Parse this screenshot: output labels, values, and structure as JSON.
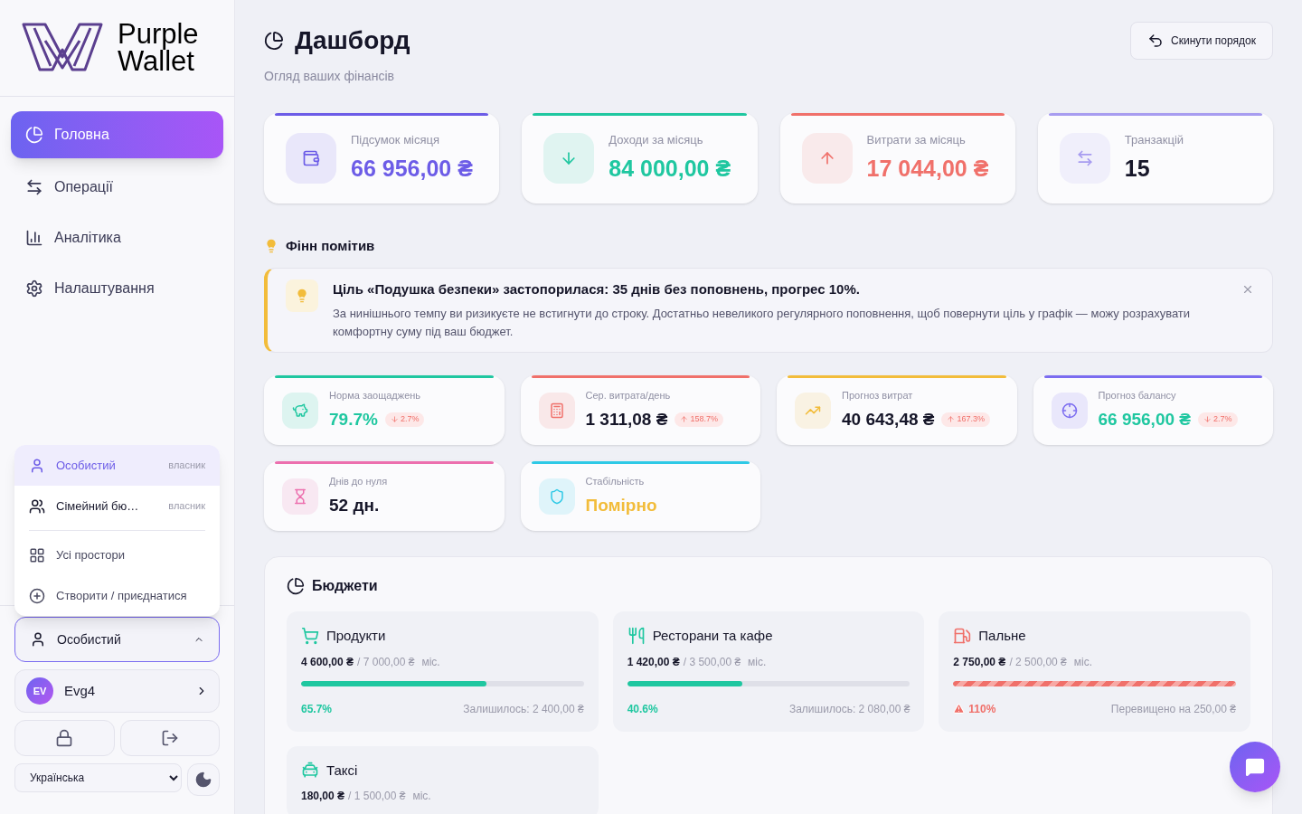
{
  "brand": {
    "lines": [
      "Purple",
      "Wallet"
    ]
  },
  "nav": [
    {
      "label": "Головна",
      "selected": true
    },
    {
      "label": "Операції",
      "selected": false
    },
    {
      "label": "Аналітика",
      "selected": false
    },
    {
      "label": "Налаштування",
      "selected": false
    }
  ],
  "space_menu": {
    "spaces": [
      {
        "label": "Особистий",
        "role": "власник",
        "selected": true
      },
      {
        "label": "Сімейний бю…",
        "role": "власник",
        "selected": false
      }
    ],
    "actions": [
      "Усі простори",
      "Створити / приєднатися"
    ]
  },
  "space_select": {
    "label": "Особистий",
    "expanded": true
  },
  "user": {
    "initials": "EV",
    "name": "Evg4"
  },
  "language": "Українська",
  "header": {
    "title": "Дашборд",
    "subtitle": "Огляд ваших фінансів",
    "reset_button": "Скинути порядок"
  },
  "summary_cards": [
    {
      "label": "Підсумок місяця",
      "value": "66 956,00 ₴",
      "color": "#6c5ce7",
      "kind": "accent"
    },
    {
      "label": "Доходи за місяць",
      "value": "84 000,00 ₴",
      "color": "#1fc7a0",
      "kind": "accent"
    },
    {
      "label": "Витрати за місяць",
      "value": "17 044,00 ₴",
      "color": "#f0706a",
      "kind": "accent"
    },
    {
      "label": "Транзакцій",
      "value": "15",
      "color": "#a79cf0",
      "kind": "plain"
    }
  ],
  "insights": {
    "title": "Фінн помітив",
    "alert": {
      "title": "Ціль «Подушка безпеки» застопорилася: 35 днів без поповнень, прогрес 10%.",
      "text": "За нинішнього темпу ви ризикуєте не встигнути до строку. Достатньо невеликого регулярного поповнення, щоб повернути ціль у графік — можу розрахувати комфортну суму під ваш бюджет."
    }
  },
  "metric_cards": [
    {
      "label": "Норма заощаджень",
      "value": "79.7%",
      "color": "#1fc7a0",
      "kind": "positive",
      "change": {
        "text": "2.7%",
        "rising": false
      }
    },
    {
      "label": "Сер. витрата/день",
      "value": "1 311,08 ₴",
      "color": "#f0706a",
      "kind": "plain",
      "change": {
        "text": "158.7%",
        "rising": true
      }
    },
    {
      "label": "Прогноз витрат",
      "value": "40 643,48 ₴",
      "color": "#f2bc3a",
      "kind": "plain",
      "change": {
        "text": "167.3%",
        "rising": true
      }
    },
    {
      "label": "Прогноз балансу",
      "value": "66 956,00 ₴",
      "color": "#7b6cf0",
      "kind": "positive",
      "change": {
        "text": "2.7%",
        "rising": false
      }
    },
    {
      "label": "Днів до нуля",
      "value": "52 дн.",
      "color": "#ec6fae",
      "kind": "plain"
    },
    {
      "label": "Стабільність",
      "value": "Помірно",
      "color": "#2ec9e6",
      "kind": "warning"
    }
  ],
  "budgets": {
    "title": "Бюджети",
    "items": [
      {
        "name": "Продукти",
        "spent": "4 600,00 ₴",
        "limit": "/ 7 000,00 ₴",
        "period": "міс.",
        "level": 0.657,
        "percent": "65.7%",
        "remaining": "Залишилось: 2 400,00 ₴",
        "over": false
      },
      {
        "name": "Ресторани та кафе",
        "spent": "1 420,00 ₴",
        "limit": "/ 3 500,00 ₴",
        "period": "міс.",
        "level": 0.406,
        "percent": "40.6%",
        "remaining": "Залишилось: 2 080,00 ₴",
        "over": false
      },
      {
        "name": "Пальне",
        "spent": "2 750,00 ₴",
        "limit": "/ 2 500,00 ₴",
        "period": "міс.",
        "level": 1,
        "percent": "110%",
        "remaining": "Перевищено на 250,00 ₴",
        "over": true
      },
      {
        "name": "Таксі",
        "spent": "180,00 ₴",
        "limit": "/ 1 500,00 ₴",
        "period": "міс."
      }
    ]
  }
}
